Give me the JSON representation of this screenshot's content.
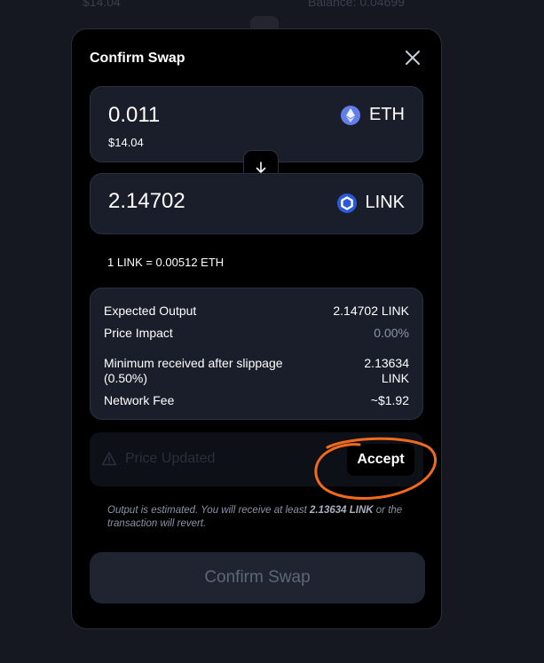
{
  "background": {
    "left_value": "$14.04",
    "right_value": "Balance: 0.04699"
  },
  "modal": {
    "title": "Confirm Swap",
    "close_icon": "close-icon"
  },
  "from": {
    "amount": "0.011",
    "usd": "$14.04",
    "token": "ETH",
    "icon": "eth-icon"
  },
  "to": {
    "amount": "2.14702",
    "token": "LINK",
    "icon": "link-icon"
  },
  "swap_arrow_icon": "arrow-down-icon",
  "rate": "1 LINK = 0.00512 ETH",
  "details": {
    "expected_output_label": "Expected Output",
    "expected_output_value": "2.14702 LINK",
    "price_impact_label": "Price Impact",
    "price_impact_value": "0.00%",
    "min_received_label_1": "Minimum received after slippage",
    "min_received_label_2": "(0.50%)",
    "min_received_value_1": "2.13634",
    "min_received_value_2": "LINK",
    "network_fee_label": "Network Fee",
    "network_fee_value": "~$1.92"
  },
  "price_updated": {
    "text": "Price Updated",
    "icon": "warning-icon",
    "accept_label": "Accept",
    "annotation_color": "#f26a1b"
  },
  "note": {
    "prefix": "Output is estimated. You will receive at least ",
    "amount": "2.13634 LINK",
    "suffix": " or the transaction will revert."
  },
  "confirm_button": "Confirm Swap",
  "colors": {
    "eth": "#627eea",
    "link": "#2a5ada",
    "muted": "#8b93a7"
  }
}
